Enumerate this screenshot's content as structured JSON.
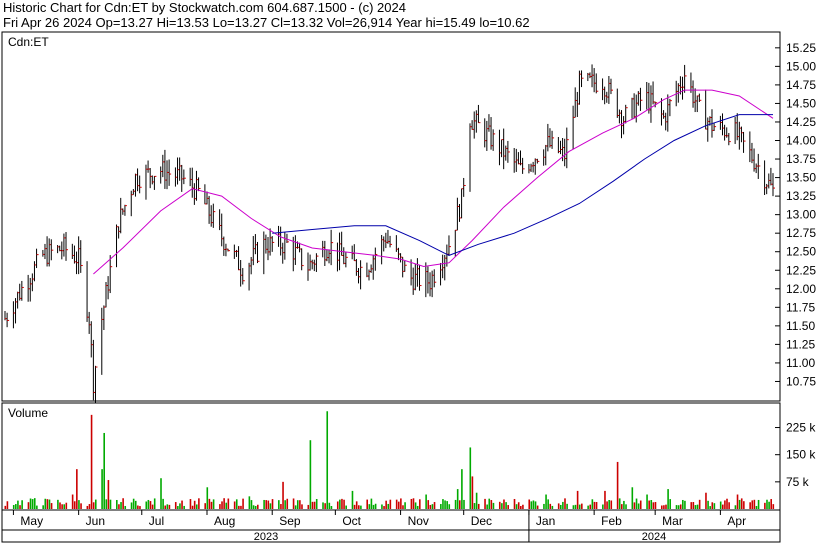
{
  "header": {
    "title": "Historic Chart for Cdn:ET by Stockwatch.com 604.687.1500 - (c) 2024",
    "summary": "Fri Apr 26 2024  Op=13.27  Hi=13.53  Lo=13.27  Cl=13.32  Vol=26,914  Year hi=15.49  lo=10.62"
  },
  "chart_data": [
    {
      "type": "ohlc",
      "symbol_label": "Cdn:ET",
      "y_ticks": [
        "15.25",
        "15.00",
        "14.75",
        "14.50",
        "14.25",
        "14.00",
        "13.75",
        "13.50",
        "13.25",
        "13.00",
        "12.75",
        "12.50",
        "12.25",
        "12.00",
        "11.75",
        "11.50",
        "11.25",
        "11.00",
        "10.75"
      ],
      "ylim": [
        10.5,
        15.45
      ],
      "x_month_labels": [
        "May",
        "Jun",
        "Jul",
        "Aug",
        "Sep",
        "Oct",
        "Nov",
        "Dec",
        "Jan",
        "Feb",
        "Mar",
        "Apr"
      ],
      "year_labels": [
        "2023",
        "2024"
      ],
      "grid": false,
      "close_anchors": [
        [
          "2023-04-27",
          11.6
        ],
        [
          "2023-05-05",
          12.0
        ],
        [
          "2023-05-15",
          12.45
        ],
        [
          "2023-05-25",
          12.55
        ],
        [
          "2023-06-01",
          12.4
        ],
        [
          "2023-06-06",
          11.6
        ],
        [
          "2023-06-08",
          10.75
        ],
        [
          "2023-06-12",
          11.6
        ],
        [
          "2023-06-20",
          12.9
        ],
        [
          "2023-06-28",
          13.5
        ],
        [
          "2023-07-10",
          13.6
        ],
        [
          "2023-07-20",
          13.5
        ],
        [
          "2023-07-28",
          13.3
        ],
        [
          "2023-08-08",
          12.7
        ],
        [
          "2023-08-18",
          12.25
        ],
        [
          "2023-08-28",
          12.6
        ],
        [
          "2023-09-08",
          12.6
        ],
        [
          "2023-09-18",
          12.3
        ],
        [
          "2023-09-28",
          12.6
        ],
        [
          "2023-10-05",
          12.4
        ],
        [
          "2023-10-15",
          12.25
        ],
        [
          "2023-10-25",
          12.7
        ],
        [
          "2023-11-05",
          12.15
        ],
        [
          "2023-11-15",
          12.1
        ],
        [
          "2023-11-24",
          12.6
        ],
        [
          "2023-11-30",
          13.2
        ],
        [
          "2023-12-04",
          14.3
        ],
        [
          "2023-12-15",
          14.0
        ],
        [
          "2023-12-28",
          13.6
        ],
        [
          "2024-01-10",
          13.95
        ],
        [
          "2024-01-18",
          13.8
        ],
        [
          "2024-01-25",
          14.75
        ],
        [
          "2024-02-05",
          14.8
        ],
        [
          "2024-02-15",
          14.3
        ],
        [
          "2024-02-25",
          14.6
        ],
        [
          "2024-03-05",
          14.3
        ],
        [
          "2024-03-15",
          14.9
        ],
        [
          "2024-03-22",
          14.4
        ],
        [
          "2024-03-28",
          14.2
        ],
        [
          "2024-04-08",
          14.1
        ],
        [
          "2024-04-18",
          13.7
        ],
        [
          "2024-04-26",
          13.32
        ]
      ],
      "ma_fast": {
        "color": "#cc00cc",
        "points": [
          [
            "2023-06-08",
            12.2
          ],
          [
            "2023-06-22",
            12.55
          ],
          [
            "2023-07-10",
            13.05
          ],
          [
            "2023-07-25",
            13.35
          ],
          [
            "2023-08-08",
            13.25
          ],
          [
            "2023-08-22",
            12.95
          ],
          [
            "2023-09-05",
            12.7
          ],
          [
            "2023-09-20",
            12.55
          ],
          [
            "2023-10-05",
            12.5
          ],
          [
            "2023-10-20",
            12.45
          ],
          [
            "2023-11-01",
            12.4
          ],
          [
            "2023-11-12",
            12.3
          ],
          [
            "2023-11-24",
            12.35
          ],
          [
            "2023-12-05",
            12.65
          ],
          [
            "2023-12-20",
            13.1
          ],
          [
            "2024-01-05",
            13.5
          ],
          [
            "2024-01-20",
            13.85
          ],
          [
            "2024-02-05",
            14.1
          ],
          [
            "2024-02-20",
            14.3
          ],
          [
            "2024-03-05",
            14.55
          ],
          [
            "2024-03-15",
            14.68
          ],
          [
            "2024-03-28",
            14.68
          ],
          [
            "2024-04-10",
            14.6
          ],
          [
            "2024-04-26",
            14.3
          ]
        ]
      },
      "ma_slow": {
        "color": "#0000aa",
        "points": [
          [
            "2023-09-01",
            12.75
          ],
          [
            "2023-09-20",
            12.8
          ],
          [
            "2023-10-10",
            12.85
          ],
          [
            "2023-10-25",
            12.85
          ],
          [
            "2023-11-10",
            12.65
          ],
          [
            "2023-11-24",
            12.45
          ],
          [
            "2023-12-08",
            12.6
          ],
          [
            "2023-12-25",
            12.75
          ],
          [
            "2024-01-10",
            12.95
          ],
          [
            "2024-01-25",
            13.15
          ],
          [
            "2024-02-10",
            13.45
          ],
          [
            "2024-02-25",
            13.75
          ],
          [
            "2024-03-10",
            14.0
          ],
          [
            "2024-03-25",
            14.2
          ],
          [
            "2024-04-10",
            14.35
          ],
          [
            "2024-04-26",
            14.35
          ]
        ]
      }
    },
    {
      "type": "bar",
      "title": "Volume",
      "y_ticks": [
        "225 k",
        "150 k",
        "75 k"
      ],
      "ylim": [
        0,
        290000
      ],
      "colors": {
        "up": "#00aa00",
        "down": "#cc0000"
      },
      "spikes": [
        [
          "2023-05-12",
          30000
        ],
        [
          "2023-05-30",
          40000
        ],
        [
          "2023-06-01",
          110000
        ],
        [
          "2023-06-08",
          260000
        ],
        [
          "2023-06-12",
          110000
        ],
        [
          "2023-06-14",
          210000
        ],
        [
          "2023-06-16",
          80000
        ],
        [
          "2023-07-11",
          85000
        ],
        [
          "2023-08-02",
          60000
        ],
        [
          "2023-08-20",
          35000
        ],
        [
          "2023-09-07",
          75000
        ],
        [
          "2023-09-20",
          190000
        ],
        [
          "2023-09-28",
          270000
        ],
        [
          "2023-10-10",
          50000
        ],
        [
          "2023-11-14",
          40000
        ],
        [
          "2023-11-29",
          55000
        ],
        [
          "2023-12-01",
          110000
        ],
        [
          "2023-12-04",
          170000
        ],
        [
          "2023-12-06",
          90000
        ],
        [
          "2023-12-08",
          45000
        ],
        [
          "2024-01-10",
          40000
        ],
        [
          "2024-01-25",
          50000
        ],
        [
          "2024-02-07",
          50000
        ],
        [
          "2024-02-13",
          130000
        ],
        [
          "2024-02-20",
          60000
        ],
        [
          "2024-02-27",
          40000
        ],
        [
          "2024-03-08",
          55000
        ],
        [
          "2024-03-25",
          45000
        ],
        [
          "2024-04-10",
          40000
        ]
      ]
    }
  ]
}
